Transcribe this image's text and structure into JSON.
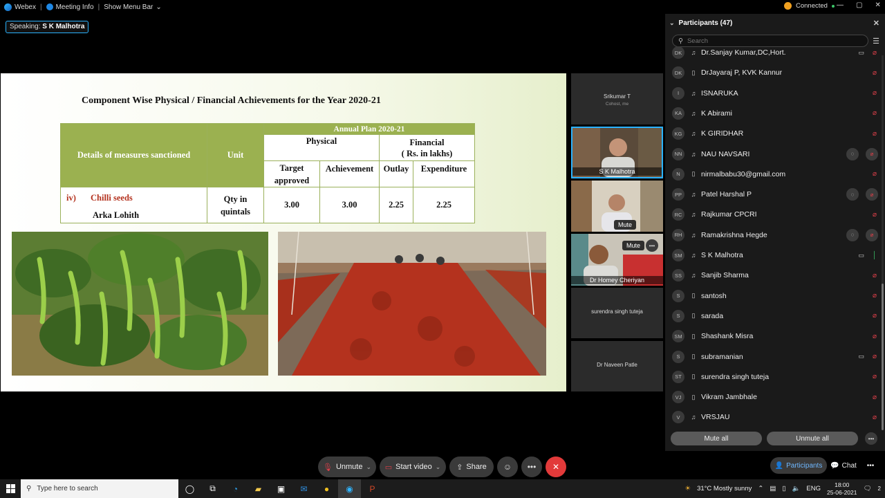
{
  "topbar": {
    "app_name": "Webex",
    "meeting_info": "Meeting Info",
    "show_menu_bar": "Show Menu Bar",
    "status": "Connected",
    "window_controls": [
      "—",
      "▢",
      "✕"
    ]
  },
  "speaking": {
    "label": "Speaking:",
    "name": "S K Malhotra"
  },
  "slide": {
    "title": "Component Wise Physical / Financial Achievements  for the Year 2020-21",
    "table": {
      "header_details": "Details of measures sanctioned",
      "header_unit": "Unit",
      "header_annual_plan": "Annual Plan 2020-21",
      "header_physical": "Physical",
      "header_financial_1": "Financial",
      "header_financial_2": "( Rs. in lakhs)",
      "col_target_1": "Target",
      "col_target_2": "approved",
      "col_achievement": "Achievement",
      "col_outlay": "Outlay",
      "col_expenditure": "Expenditure",
      "row_num": "iv)",
      "row_item": "Chilli seeds",
      "row_variety": "Arka Lohith",
      "row_unit_1": "Qty in",
      "row_unit_2": "quintals",
      "row_target": "3.00",
      "row_achievement": "3.00",
      "row_outlay": "2.25",
      "row_expenditure": "2.25"
    }
  },
  "tiles": {
    "srikumar_name": "Srikumar T",
    "srikumar_role": "Cohost, me",
    "malhotra": "S K Malhotra",
    "mute_1": "Mute",
    "mute_2": "Mute",
    "cheriyan": "Dr Homey Cheriyan",
    "tuteja": "surendra singh tuteja",
    "patle": "Dr Naveen Patle"
  },
  "panel": {
    "title": "Participants (47)",
    "search_placeholder": "Search",
    "participants": [
      {
        "initials": "DK",
        "name": "Dr.Sanjay Kumar,DC,Hort.",
        "device": "headset",
        "cam": true,
        "mic": "muted",
        "extra": false
      },
      {
        "initials": "DK",
        "name": "DrJayaraj P, KVK Kannur",
        "device": "phone",
        "cam": false,
        "mic": "muted",
        "extra": false
      },
      {
        "initials": "I",
        "name": "ISNARUKA",
        "device": "headset",
        "cam": false,
        "mic": "muted",
        "extra": false
      },
      {
        "initials": "KA",
        "name": "K Abirami",
        "device": "headset",
        "cam": false,
        "mic": "muted",
        "extra": false
      },
      {
        "initials": "KG",
        "name": "K GIRIDHAR",
        "device": "headset",
        "cam": false,
        "mic": "muted",
        "extra": false
      },
      {
        "initials": "NN",
        "name": "NAU NAVSARI",
        "device": "headset",
        "cam": false,
        "mic": "muted",
        "extra": true
      },
      {
        "initials": "N",
        "name": "nirmalbabu30@gmail.com",
        "device": "phone",
        "cam": false,
        "mic": "muted",
        "extra": false
      },
      {
        "initials": "PP",
        "name": "Patel Harshal P",
        "device": "headset",
        "cam": false,
        "mic": "muted",
        "extra": true
      },
      {
        "initials": "RC",
        "name": "Rajkumar CPCRI",
        "device": "headset",
        "cam": false,
        "mic": "muted",
        "extra": false
      },
      {
        "initials": "RH",
        "name": "Ramakrishna Hegde",
        "device": "headset",
        "cam": false,
        "mic": "muted",
        "extra": true
      },
      {
        "initials": "SM",
        "name": "S K Malhotra",
        "device": "headset",
        "cam": true,
        "mic": "on",
        "extra": false
      },
      {
        "initials": "SS",
        "name": "Sanjib Sharma",
        "device": "headset",
        "cam": false,
        "mic": "muted",
        "extra": false
      },
      {
        "initials": "S",
        "name": "santosh",
        "device": "phone",
        "cam": false,
        "mic": "muted",
        "extra": false
      },
      {
        "initials": "S",
        "name": "sarada",
        "device": "phone",
        "cam": false,
        "mic": "muted",
        "extra": false
      },
      {
        "initials": "SM",
        "name": "Shashank Misra",
        "device": "phone",
        "cam": false,
        "mic": "muted",
        "extra": false
      },
      {
        "initials": "S",
        "name": "subramanian",
        "device": "phone",
        "cam": true,
        "mic": "muted",
        "extra": false
      },
      {
        "initials": "ST",
        "name": "surendra singh tuteja",
        "device": "phone",
        "cam": false,
        "mic": "muted",
        "extra": false
      },
      {
        "initials": "VJ",
        "name": "Vikram Jambhale",
        "device": "phone",
        "cam": false,
        "mic": "muted",
        "extra": false
      },
      {
        "initials": "V",
        "name": "VRSJAU",
        "device": "headset",
        "cam": false,
        "mic": "muted",
        "extra": false
      }
    ],
    "mute_all": "Mute all",
    "unmute_all": "Unmute all"
  },
  "controls": {
    "unmute": "Unmute",
    "start_video": "Start video",
    "share": "Share",
    "participants_tab": "Participants",
    "chat_tab": "Chat"
  },
  "taskbar": {
    "search_placeholder": "Type here to search",
    "weather": "31°C  Mostly sunny",
    "lang": "ENG",
    "time": "18:00",
    "date": "25-06-2021",
    "notif_count": "2"
  },
  "colors": {
    "slide_olive": "#9bb150",
    "accent_blue": "#2ab3ff",
    "muted_red": "#e0404a",
    "end_red": "#e23a3a"
  }
}
